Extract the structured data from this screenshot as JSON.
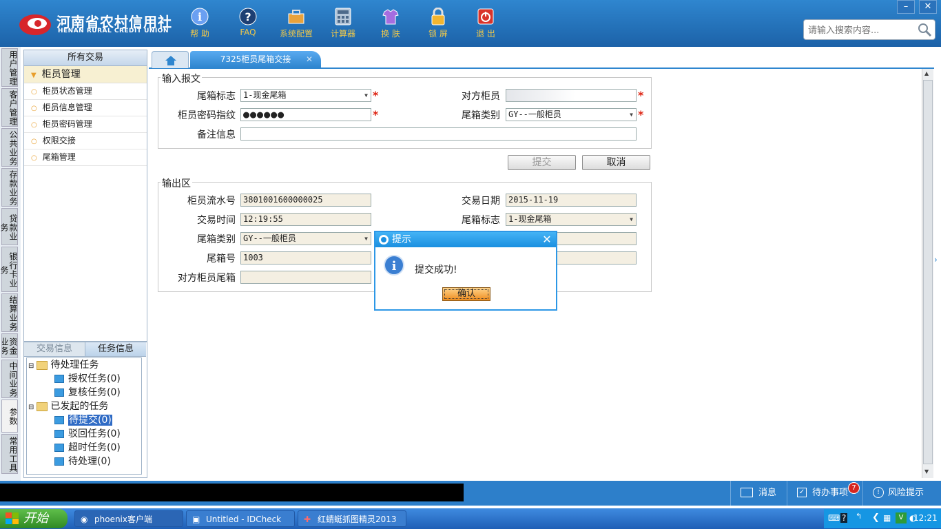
{
  "app": {
    "logo_cn": "河南省农村信用社",
    "logo_en": "HENAN RURAL CREDIT UNION",
    "toolbar": [
      {
        "label": "帮 助",
        "icon": "info-icon"
      },
      {
        "label": "FAQ",
        "icon": "faq-icon"
      },
      {
        "label": "系统配置",
        "icon": "toolbox-icon"
      },
      {
        "label": "计算器",
        "icon": "calculator-icon"
      },
      {
        "label": "换 肤",
        "icon": "shirt-icon"
      },
      {
        "label": "锁 屏",
        "icon": "lock-icon"
      },
      {
        "label": "退 出",
        "icon": "power-icon"
      }
    ],
    "search_placeholder": "请输入搜索内容...",
    "window_minimize": "–",
    "window_close": "✕"
  },
  "vtabs": [
    "用户管理",
    "客户管理",
    "公共业务",
    "存款业务",
    "贷款业务",
    "银行卡业务",
    "结算业务",
    "资金业务",
    "中间业务",
    "参数",
    "常用工具"
  ],
  "menu": {
    "header": "所有交易",
    "group": "柜员管理",
    "items": [
      "柜员状态管理",
      "柜员信息管理",
      "柜员密码管理",
      "权限交接",
      "尾箱管理"
    ]
  },
  "task_panel": {
    "tab_trade": "交易信息",
    "tab_task": "任务信息",
    "pending_group": "待处理任务",
    "pending_children": [
      "授权任务(0)",
      "复核任务(0)"
    ],
    "initiated_group": "已发起的任务",
    "initiated_children": [
      "待提交(0)",
      "驳回任务(0)",
      "超时任务(0)",
      "待处理(0)"
    ]
  },
  "tabs": {
    "active": "7325柜员尾箱交接",
    "close": "✕"
  },
  "input_section": {
    "legend": "输入报文",
    "tail_flag_label": "尾箱标志",
    "tail_flag_value": "1-现金尾箱",
    "counter_teller_label": "对方柜员",
    "counter_teller_value": "",
    "password_label": "柜员密码指纹",
    "password_value": "●●●●●●",
    "tail_type_label": "尾箱类别",
    "tail_type_value": "GY--一般柜员",
    "remark_label": "备注信息",
    "remark_value": "",
    "required_mark": "*"
  },
  "buttons": {
    "submit": "提交",
    "cancel": "取消"
  },
  "output_section": {
    "legend": "输出区",
    "serial_label": "柜员流水号",
    "serial_value": "3801001600000025",
    "date_label": "交易日期",
    "date_value": "2015-11-19",
    "time_label": "交易时间",
    "time_value": "12:19:55",
    "out_tail_flag_label": "尾箱标志",
    "out_tail_flag_value": "1-现金尾箱",
    "out_tail_type_label": "尾箱类别",
    "out_tail_type_value": "GY--一般柜员",
    "tail_no_label": "尾箱号",
    "tail_no_value": "1003",
    "counter_tail_label": "对方柜员尾箱",
    "counter_tail_value": ""
  },
  "dialog": {
    "title": "提示",
    "message": "提交成功!",
    "ok": "确认",
    "close": "✕"
  },
  "statusbar": {
    "messages": "消息",
    "todo": "待办事项",
    "todo_badge": "7",
    "risk": "风险提示"
  },
  "taskbar": {
    "start": "开始",
    "tasks": [
      "phoenix客户端",
      "Untitled - IDCheck",
      "红蜻蜓抓图精灵2013"
    ],
    "clock": "12:21"
  },
  "colors": {
    "header": "#1c62a8",
    "accent": "#2f86cf",
    "required": "#d21111",
    "dialog_ok": "#f08d1e"
  }
}
